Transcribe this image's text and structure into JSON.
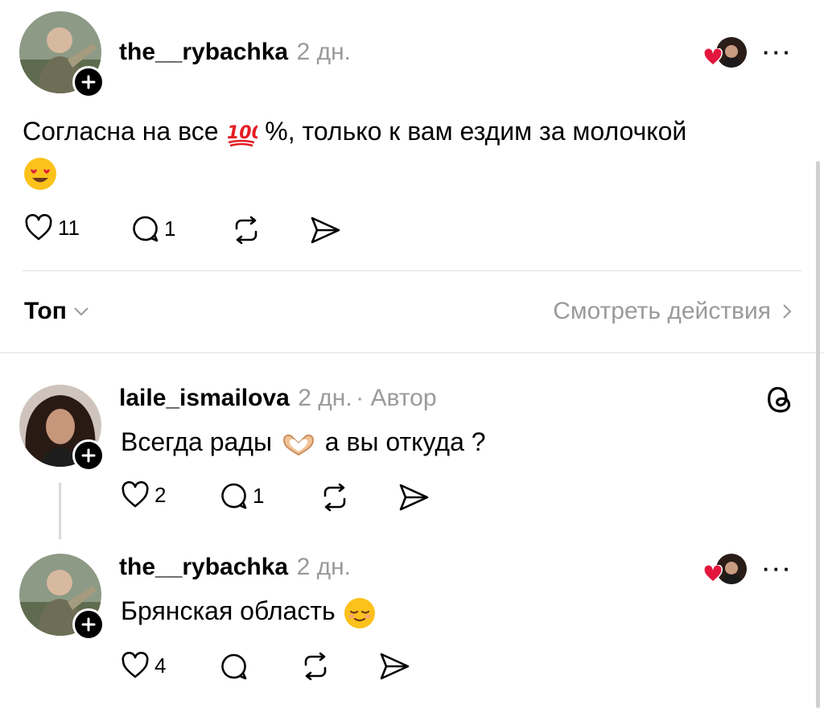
{
  "post": {
    "username": "the__rybachka",
    "time": "2 дн.",
    "text_before": "Согласна на все",
    "text_after": "%, только к вам ездим за молочкой",
    "likes": "11",
    "replies": "1",
    "more": "···"
  },
  "filter": {
    "sort_label": "Топ",
    "view_activity": "Смотреть действия"
  },
  "reply1": {
    "username": "laile_ismailova",
    "time": "2 дн.",
    "author_tag": "· Автор",
    "text_before": "Всегда рады",
    "text_after": "а вы откуда ?",
    "likes": "2",
    "replies": "1"
  },
  "reply2": {
    "username": "the__rybachka",
    "time": "2 дн.",
    "text": "Брянская область",
    "likes": "4",
    "more": "···"
  },
  "colors": {
    "heart_red": "#e3173e",
    "muted_gray": "#9a9a9a",
    "divider": "#e2e2e2"
  }
}
